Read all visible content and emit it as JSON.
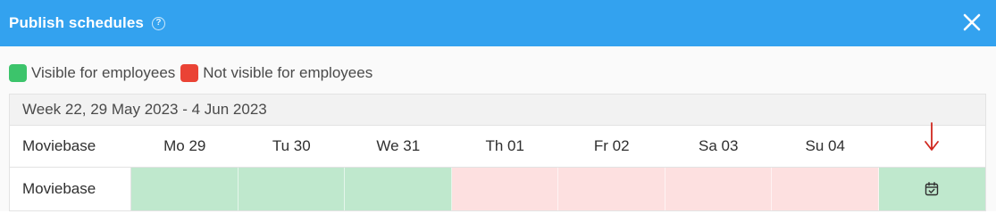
{
  "header": {
    "title": "Publish schedules",
    "help_glyph": "?",
    "accent": "#33a2ef"
  },
  "legend": {
    "visible": {
      "label": "Visible for employees",
      "color": "#3cc46b"
    },
    "not_visible": {
      "label": "Not visible for employees",
      "color": "#ea4335"
    }
  },
  "schedule": {
    "week_label": "Week 22, 29 May 2023 - 4 Jun 2023",
    "header_label": "Moviebase",
    "days": [
      "Mo 29",
      "Tu 30",
      "We 31",
      "Th 01",
      "Fr 02",
      "Sa 03",
      "Su 04"
    ],
    "rows": [
      {
        "name": "Moviebase",
        "status": [
          "visible",
          "visible",
          "visible",
          "not_visible",
          "not_visible",
          "not_visible",
          "not_visible"
        ],
        "action_status": "visible",
        "action_icon": "calendar-check-icon"
      }
    ],
    "cell_colors": {
      "visible": "#bfe8cd",
      "not_visible": "#fde0e0"
    },
    "annotation_color": "#d0281f"
  }
}
